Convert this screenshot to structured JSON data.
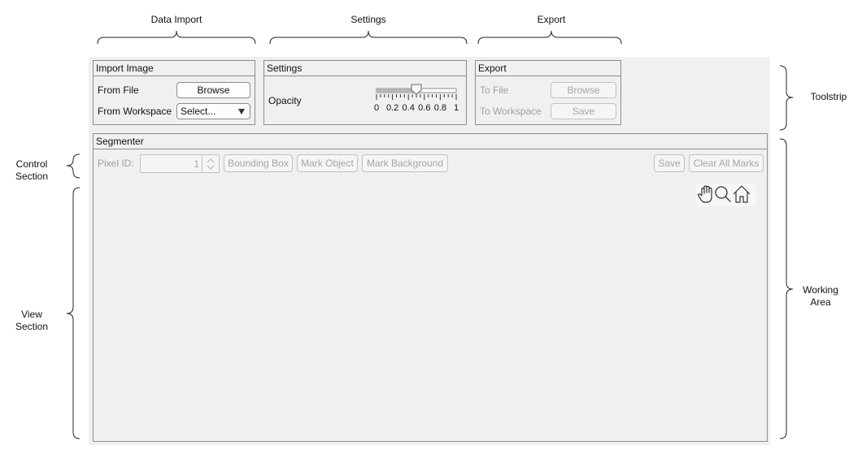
{
  "annotations": {
    "top": [
      {
        "label": "Data Import"
      },
      {
        "label": "Settings"
      },
      {
        "label": "Export"
      }
    ],
    "right": [
      {
        "label": "Toolstrip"
      },
      {
        "label_line1": "Working",
        "label_line2": "Area"
      }
    ],
    "left": [
      {
        "label_line1": "Control",
        "label_line2": "Section"
      },
      {
        "label_line1": "View",
        "label_line2": "Section"
      }
    ]
  },
  "import_panel": {
    "title": "Import Image",
    "from_file_label": "From File",
    "browse_label": "Browse",
    "from_workspace_label": "From Workspace",
    "select_value": "Select..."
  },
  "settings_panel": {
    "title": "Settings",
    "opacity_label": "Opacity",
    "slider": {
      "min": 0,
      "max": 1,
      "value": 0.5,
      "tick_labels": [
        "0",
        "0.2",
        "0.4",
        "0.6",
        "0.8",
        "1"
      ]
    }
  },
  "export_panel": {
    "title": "Export",
    "to_file_label": "To File",
    "browse_label": "Browse",
    "to_workspace_label": "To Workspace",
    "save_label": "Save"
  },
  "segmenter": {
    "title": "Segmenter",
    "pixel_id_label": "Pixel ID:",
    "pixel_id_value": "1",
    "bounding_box_label": "Bounding Box",
    "mark_object_label": "Mark Object",
    "mark_background_label": "Mark Background",
    "save_label": "Save",
    "clear_all_label": "Clear All Marks",
    "axes_toolbar": [
      "pan-icon",
      "zoom-icon",
      "home-icon"
    ]
  },
  "colors": {
    "background": "#f0f0f0",
    "border": "#8c8c8c",
    "disabled_text": "#a0a0a0"
  }
}
